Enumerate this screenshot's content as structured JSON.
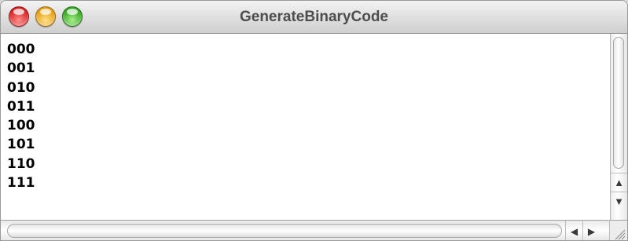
{
  "window": {
    "title": "GenerateBinaryCode"
  },
  "console": {
    "lines": [
      "000",
      "001",
      "010",
      "011",
      "100",
      "101",
      "110",
      "111"
    ]
  },
  "icons": {
    "close": "close-button-icon",
    "minimize": "minimize-button-icon",
    "zoom": "zoom-button-icon",
    "scroll_up": "arrow-up-icon",
    "scroll_down": "arrow-down-icon",
    "scroll_left": "arrow-left-icon",
    "scroll_right": "arrow-right-icon",
    "resize": "resize-grip-icon"
  },
  "colors": {
    "close": "#d61b1b",
    "minimize": "#e49a0b",
    "zoom": "#2ea21a",
    "title_text": "#4d4d4d",
    "content_bg": "#ffffff"
  }
}
